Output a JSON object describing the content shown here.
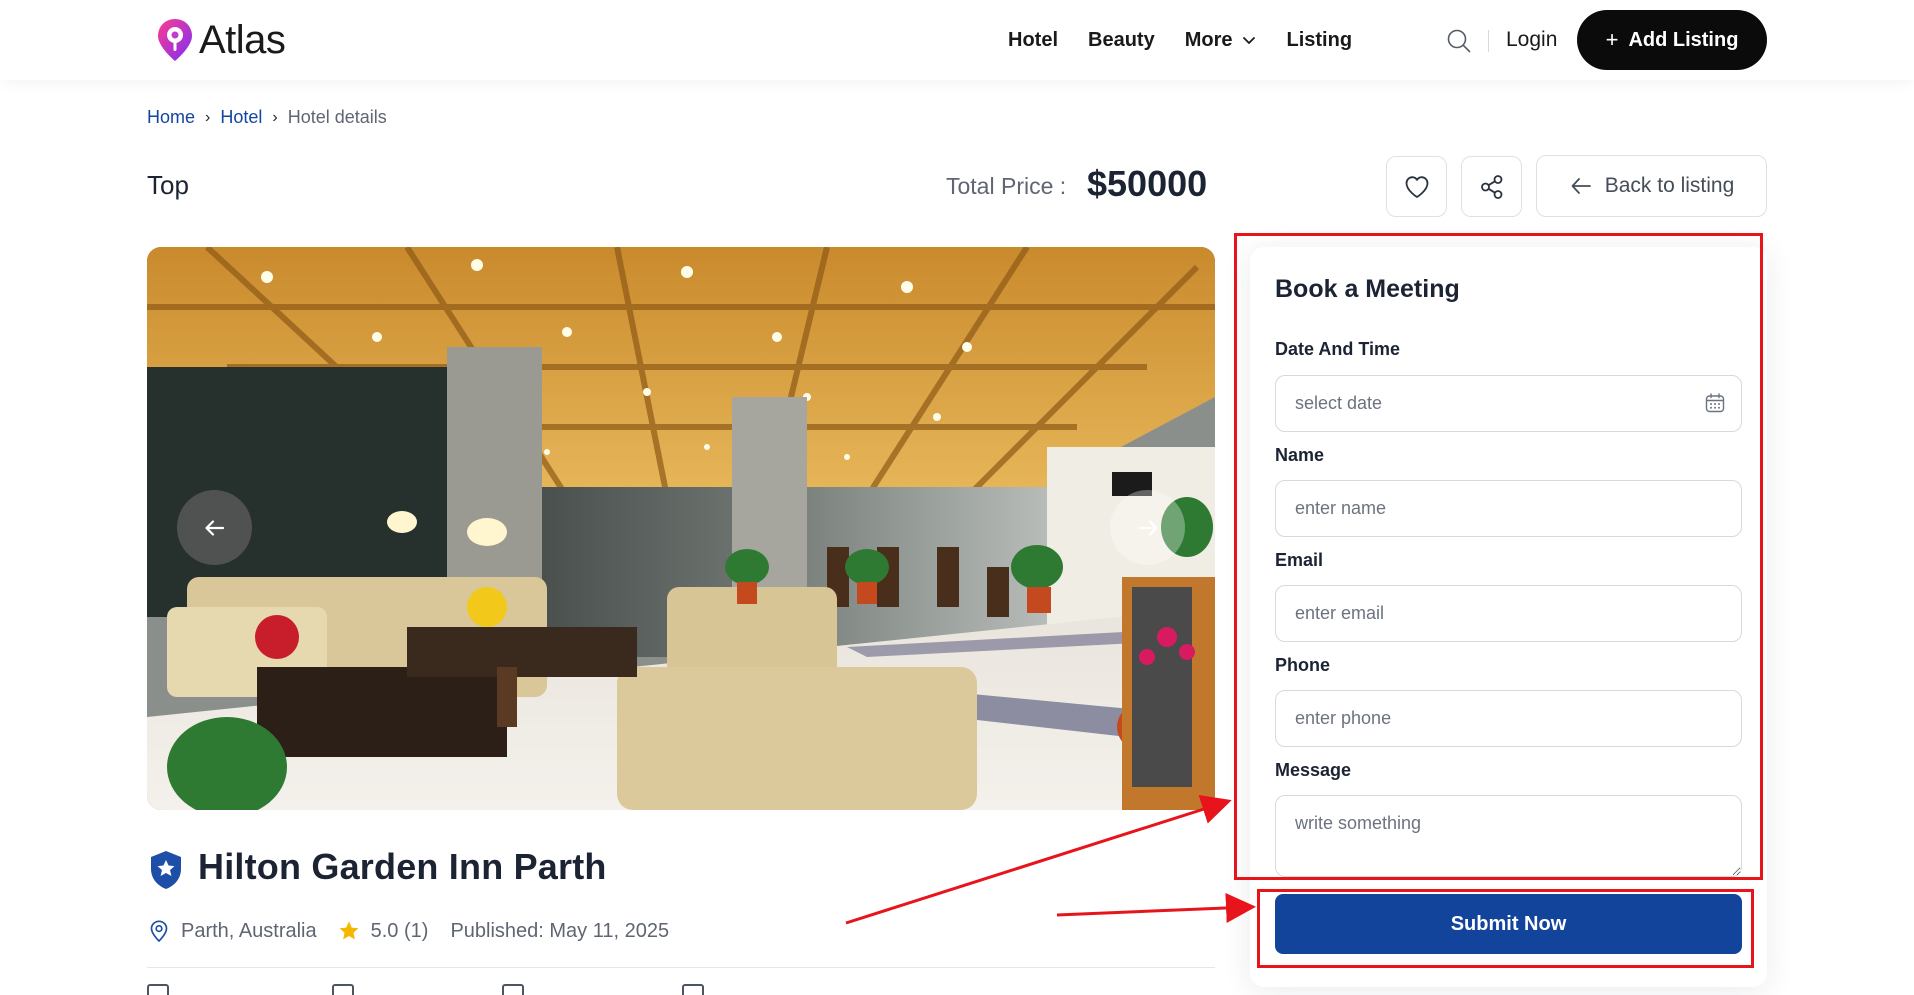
{
  "brand": {
    "name": "Atlas"
  },
  "nav": {
    "items": [
      {
        "label": "Hotel"
      },
      {
        "label": "Beauty"
      },
      {
        "label": "More",
        "has_dropdown": true
      },
      {
        "label": "Listing"
      }
    ],
    "login_label": "Login",
    "add_listing_label": "Add Listing"
  },
  "breadcrumb": {
    "items": [
      "Home",
      "Hotel",
      "Hotel details"
    ]
  },
  "listing": {
    "tag": "Top",
    "price_label": "Total Price :",
    "price_value": "$50000",
    "back_label": "Back to listing",
    "title": "Hilton Garden Inn Parth",
    "location": "Parth, Australia",
    "rating": "5.0 (1)",
    "published": "Published: May 11, 2025"
  },
  "booking": {
    "title": "Book a Meeting",
    "fields": {
      "date": {
        "label": "Date And Time",
        "placeholder": "select date",
        "value": ""
      },
      "name": {
        "label": "Name",
        "placeholder": "enter name",
        "value": ""
      },
      "email": {
        "label": "Email",
        "placeholder": "enter email",
        "value": ""
      },
      "phone": {
        "label": "Phone",
        "placeholder": "enter phone",
        "value": ""
      },
      "message": {
        "label": "Message",
        "placeholder": "write something",
        "value": ""
      }
    },
    "submit_label": "Submit Now"
  },
  "colors": {
    "primary": "#12449c",
    "link": "#1246a0",
    "annotation": "#e8141c",
    "star": "#f5b800",
    "dark_button": "#0b0b0b"
  },
  "icons": [
    "logo-pin-icon",
    "chevron-down-icon",
    "search-icon",
    "plus-icon",
    "heart-icon",
    "share-icon",
    "arrow-left-icon",
    "arrow-right-icon",
    "verified-shield-icon",
    "location-pin-icon",
    "star-icon",
    "calendar-icon"
  ]
}
